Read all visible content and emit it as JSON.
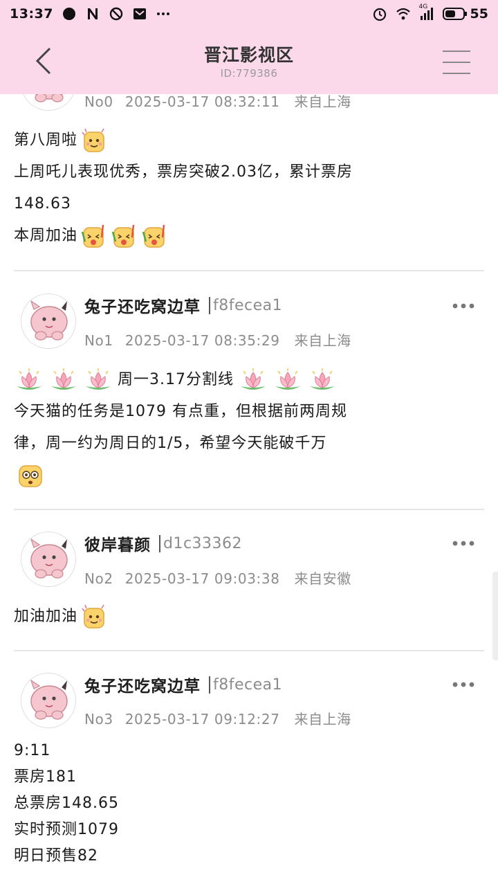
{
  "status_bar": {
    "time": "13:37",
    "battery": "55",
    "network": "4G"
  },
  "header": {
    "title": "晋江影视区",
    "subtitle": "ID:779386"
  },
  "posts": [
    {
      "floor": "No0",
      "datetime": "2025-03-17 08:32:11",
      "location": "来自上海",
      "lines": [
        "第八周啦",
        "上周吒儿表现优秀，票房突破2.03亿，累计票房",
        "148.63",
        "本周加油"
      ]
    },
    {
      "user": "兔子还吃窝边草",
      "uid": "f8fecea1",
      "floor": "No1",
      "datetime": "2025-03-17 08:35:29",
      "location": "来自上海",
      "lines": [
        "周一3.17分割线",
        "今天猫的任务是1079 有点重，但根据前两周规",
        "律，周一约为周日的1/5，希望今天能破千万"
      ]
    },
    {
      "user": "彼岸暮颜",
      "uid": "d1c33362",
      "floor": "No2",
      "datetime": "2025-03-17 09:03:38",
      "location": "来自安徽",
      "lines": [
        "加油加油"
      ]
    },
    {
      "user": "兔子还吃窝边草",
      "uid": "f8fecea1",
      "floor": "No3",
      "datetime": "2025-03-17 09:12:27",
      "location": "来自上海",
      "lines": [
        "9:11",
        "票房181",
        "总票房148.65",
        "实时预测1079",
        "明日预售82"
      ]
    }
  ],
  "colors": {
    "header_bg": "#fcd9ea",
    "meta_text": "#8c8c8c",
    "divider": "#e6e6e6"
  }
}
